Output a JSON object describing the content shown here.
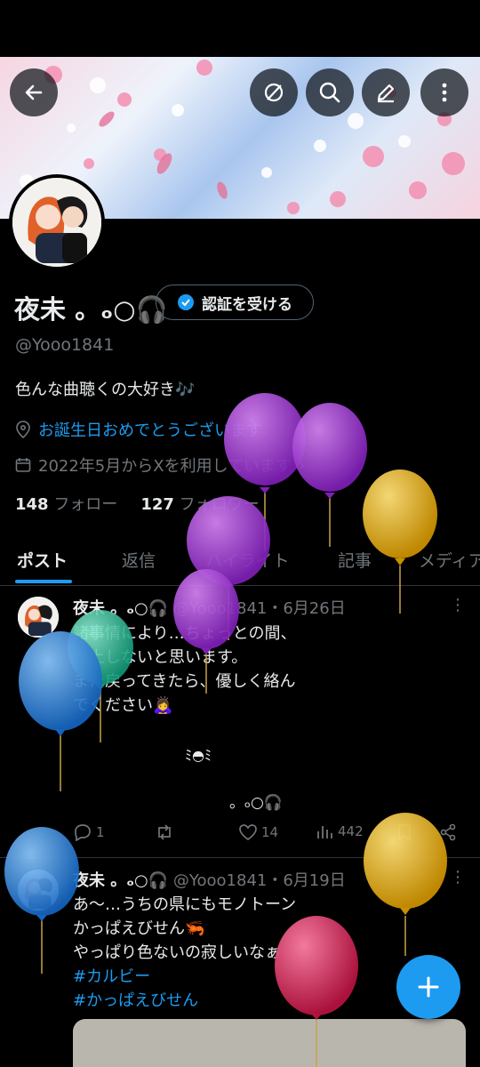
{
  "banner": {
    "description": "sakura pattern"
  },
  "header_buttons": [
    {
      "name": "back-icon"
    },
    {
      "name": "pin-icon"
    },
    {
      "name": "search-icon"
    },
    {
      "name": "edit-icon"
    },
    {
      "name": "more-icon"
    }
  ],
  "profile": {
    "name": "夜未 。ₒ○🎧",
    "verify_label": "認証を受ける",
    "handle": "@Yooo1841",
    "bio": "色んな曲聴くの大好き🎶",
    "birthday": "お誕生日おめでとうございます",
    "joined": "2022年5月からXを利用しています",
    "following_count": "148",
    "following_label": "フォロー",
    "followers_count": "127",
    "followers_label": "フォロワー"
  },
  "tabs": [
    "ポスト",
    "返信",
    "ハイライト",
    "記事",
    "メディア"
  ],
  "posts": [
    {
      "name": "夜未 。ₒ○🎧",
      "handle_date": "@Yooo1841・6月26日",
      "lines": [
        "諸事情により…ちょっとの間、",
        "浮上しないと思います。",
        "また戻ってきたら、優しく絡ん",
        "でください🙇‍♀️",
        "",
        "ﾐ◓ﾐ",
        "",
        "。ₒ○🎧"
      ],
      "replies": "1",
      "likes": "14",
      "views": "442"
    },
    {
      "name": "夜未 。ₒ○🎧",
      "handle_date": "@Yooo1841・6月19日",
      "lines": [
        "あ〜…うちの県にもモノトーン",
        "かっぱえびせん🦐",
        "やっぱり色ないの寂しいなぁ"
      ],
      "tags": [
        "#カルビー",
        "#かっぱえびせん"
      ]
    }
  ],
  "colors": {
    "accent": "#1d9bf0",
    "muted": "#71767b",
    "text": "#e7e9ea",
    "balloon_purple": "#a03cd2",
    "balloon_yellow": "#e8b414",
    "balloon_blue": "#2d8ee6",
    "balloon_green": "#2ec4a0",
    "balloon_red": "#e0245e"
  }
}
